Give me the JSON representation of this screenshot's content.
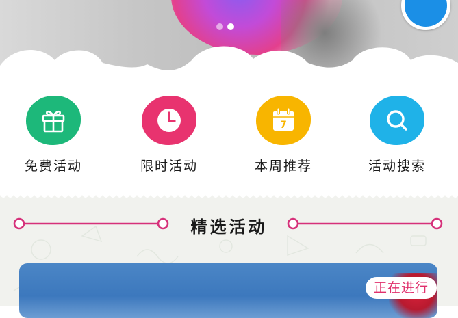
{
  "banner": {
    "dots": [
      false,
      true
    ]
  },
  "categories": [
    {
      "label": "免费活动",
      "icon": "gift-icon",
      "color": "#1db87a"
    },
    {
      "label": "限时活动",
      "icon": "clock-icon",
      "color": "#e8336f"
    },
    {
      "label": "本周推荐",
      "icon": "calendar-icon",
      "color": "#f8b500"
    },
    {
      "label": "活动搜索",
      "icon": "search-icon",
      "color": "#1fb2e8"
    }
  ],
  "calendar_day": "7",
  "section": {
    "title": "精选活动",
    "accent_color": "#d6317a"
  },
  "card": {
    "status": "正在进行"
  }
}
